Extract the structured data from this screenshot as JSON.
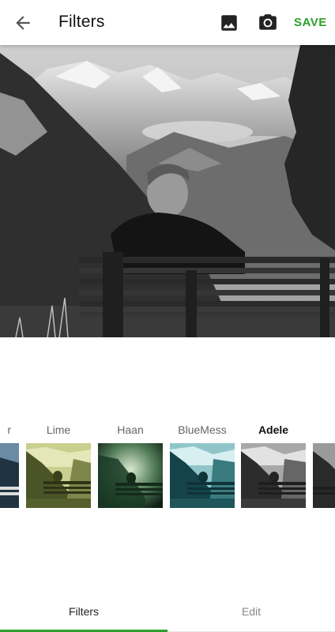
{
  "appbar": {
    "title": "Filters",
    "save_label": "SAVE",
    "icons": [
      "arrow-back-icon",
      "gallery-icon",
      "camera-icon"
    ]
  },
  "filters": {
    "items": [
      {
        "name": "r"
      },
      {
        "name": "Lime"
      },
      {
        "name": "Haan"
      },
      {
        "name": "BlueMess"
      },
      {
        "name": "Adele",
        "selected": true
      }
    ]
  },
  "tabs": [
    {
      "label": "Filters",
      "active": true
    },
    {
      "label": "Edit",
      "active": false
    }
  ],
  "colors": {
    "accent": "#2e9e2e",
    "text_primary": "#111111",
    "text_secondary": "#666666"
  }
}
